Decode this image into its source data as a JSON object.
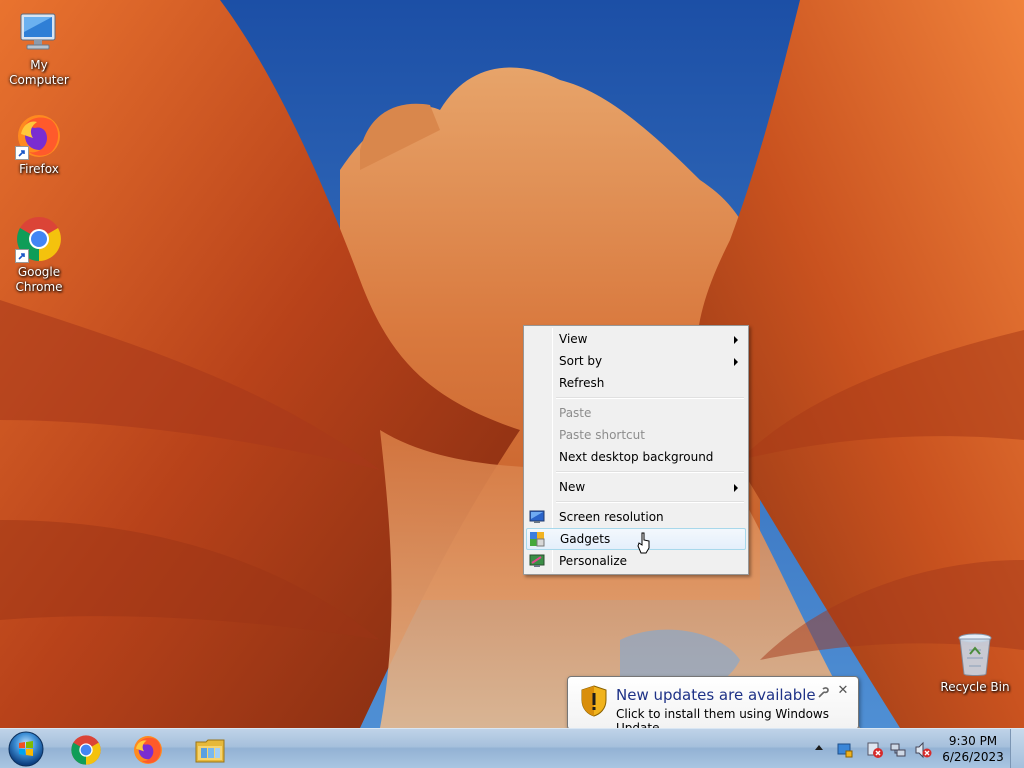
{
  "desktop": {
    "icons": [
      {
        "label": "My Computer",
        "icon": "computer-icon"
      },
      {
        "label": "Firefox",
        "icon": "firefox-icon"
      },
      {
        "label": "Google Chrome",
        "icon": "chrome-icon"
      },
      {
        "label": "Recycle Bin",
        "icon": "recycle-bin-icon"
      }
    ]
  },
  "context_menu": {
    "items": [
      {
        "label": "View",
        "submenu": true,
        "enabled": true
      },
      {
        "label": "Sort by",
        "submenu": true,
        "enabled": true
      },
      {
        "label": "Refresh",
        "enabled": true
      },
      {
        "label": "Paste",
        "enabled": false
      },
      {
        "label": "Paste shortcut",
        "enabled": false
      },
      {
        "label": "Next desktop background",
        "enabled": true
      },
      {
        "label": "New",
        "submenu": true,
        "enabled": true
      },
      {
        "label": "Screen resolution",
        "icon": "screen-resolution-icon",
        "enabled": true
      },
      {
        "label": "Gadgets",
        "icon": "gadgets-icon",
        "enabled": true,
        "highlighted": true
      },
      {
        "label": "Personalize",
        "icon": "personalize-icon",
        "enabled": true
      }
    ]
  },
  "notification": {
    "title": "New updates are available",
    "text": "Click to install them using Windows Update.",
    "icon": "shield-warning-icon"
  },
  "taskbar": {
    "pinned": [
      "chrome-icon",
      "firefox-icon",
      "file-explorer-icon"
    ],
    "clock": {
      "time": "9:30 PM",
      "date": "6/26/2023"
    },
    "tray_icons": [
      "windows-update-icon",
      "action-center-icon",
      "network-icon",
      "volume-muted-icon"
    ]
  },
  "colors": {
    "balloon_title": "#1e3287",
    "menu_background": "#f0f0f0",
    "menu_highlight_border": "#a8d8eb"
  }
}
